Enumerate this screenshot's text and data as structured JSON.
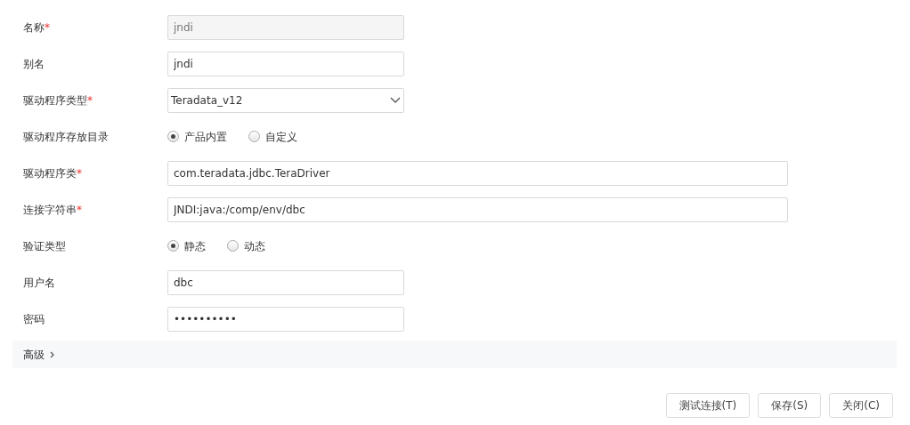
{
  "fields": [
    {
      "kind": "text",
      "label": "名称",
      "required_mark": "*",
      "value": "jndi",
      "disabled": true,
      "wide": false
    },
    {
      "kind": "text",
      "label": "别名",
      "value": "jndi",
      "disabled": false,
      "wide": false
    },
    {
      "kind": "select",
      "label": "驱动程序类型",
      "required_mark": "*",
      "value": "Teradata_v12"
    },
    {
      "kind": "radio",
      "label": "驱动程序存放目录",
      "options": [
        {
          "label": "产品内置",
          "selected": true
        },
        {
          "label": "自定义",
          "selected": false
        }
      ]
    },
    {
      "kind": "text",
      "label": "驱动程序类",
      "required_mark": "*",
      "value": "com.teradata.jdbc.TeraDriver",
      "disabled": false,
      "wide": true
    },
    {
      "kind": "text",
      "label": "连接字符串",
      "required_mark": "*",
      "value": "JNDI:java:/comp/env/dbc",
      "disabled": false,
      "wide": true
    },
    {
      "kind": "radio",
      "label": "验证类型",
      "options": [
        {
          "label": "静态",
          "selected": true
        },
        {
          "label": "动态",
          "selected": false
        }
      ]
    },
    {
      "kind": "text",
      "label": "用户名",
      "value": "dbc",
      "disabled": false,
      "wide": false
    },
    {
      "kind": "text",
      "label": "密码",
      "value": "••••••••••",
      "disabled": false,
      "wide": false
    }
  ],
  "advanced": {
    "label": "高级",
    "expanded": false
  },
  "buttons": [
    "测试连接(T)",
    "保存(S)",
    "关闭(C)"
  ]
}
